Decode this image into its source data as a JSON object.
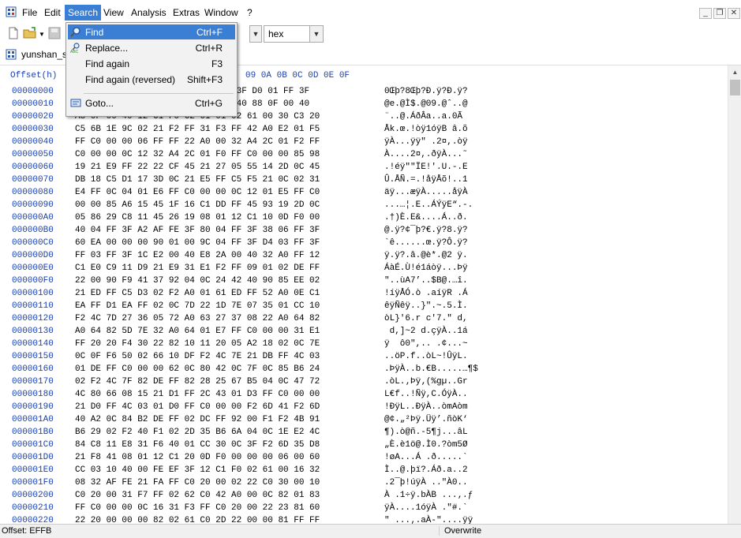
{
  "menubar": {
    "items": [
      "File",
      "Edit",
      "Search",
      "View",
      "Analysis",
      "Extras",
      "Window",
      "?"
    ],
    "active": "Search"
  },
  "toolbar": {
    "encoding_value": "hex"
  },
  "tab": {
    "label": "yunshan_s"
  },
  "hexview": {
    "offset_header": "Offset(h)",
    "column_header": "09 0A 0B 0C 0D 0E 0F",
    "rows": [
      {
        "off": "00000000",
        "hex": "                         03 FF 3F D0 01 FF 3F",
        "asc": "0Œþ?8Œþ?Ð.ÿ?Ð.ÿ?"
      },
      {
        "off": "00000010",
        "hex": "                         39 00 40 88 0F 00 40",
        "asc": "@e.@Ì$.@09.@ˆ..@"
      },
      {
        "off": "00000020",
        "hex": "A8 0F 00 40 12 C1 F0 C2 61 01 02 61 00 30 C3 20",
        "asc": "¨..@.ÁðÂa..a.0Ã "
      },
      {
        "off": "00000030",
        "hex": "C5 6B 1E 9C 02 21 F2 FF 31 F3 FF 42 A0 E2 01 F5",
        "asc": "Åk.œ.!òÿ1óÿB â.õ"
      },
      {
        "off": "00000040",
        "hex": "FF C0 00 00 06 FF FF 22 A0 00 32 A4 2C 01 F2 FF",
        "asc": "ÿÀ...ÿÿ\" .2¤,.òÿ"
      },
      {
        "off": "00000050",
        "hex": "C0 00 00 0C 12 32 A4 2C 01 F0 FF C0 00 00 85 98",
        "asc": "À....2¤,.ðÿÀ...˜"
      },
      {
        "off": "00000060",
        "hex": "19 21 E9 FF 22 22 CF 45 21 27 05 55 14 2D 0C 45",
        "asc": ".!éÿ\"\"ÏE!'.U.-.E"
      },
      {
        "off": "00000070",
        "hex": "DB 18 C5 D1 17 3D 0C 21 E5 FF C5 F5 21 0C 02 31",
        "asc": "Û.ÅÑ.=.!åÿÅõ!..1"
      },
      {
        "off": "00000080",
        "hex": "E4 FF 0C 04 01 E6 FF C0 00 00 0C 12 01 E5 FF C0",
        "asc": "äÿ...æÿÀ.....åÿÀ"
      },
      {
        "off": "00000090",
        "hex": "00 00 85 A6 15 45 1F 16 C1 DD FF 45 93 19 2D 0C",
        "asc": "...…¦.E..ÁÝÿE“.-."
      },
      {
        "off": "000000A0",
        "hex": "05 86 29 C8 11 45 26 19 08 01 12 C1 10 0D F0 00",
        "asc": ".†)È.E&....Á..ð."
      },
      {
        "off": "000000B0",
        "hex": "40 04 FF 3F A2 AF FE 3F 80 04 FF 3F 38 06 FF 3F",
        "asc": "@.ÿ?¢¯þ?€.ÿ?8.ÿ?"
      },
      {
        "off": "000000C0",
        "hex": "60 EA 00 00 00 90 01 00 9C 04 FF 3F D4 03 FF 3F",
        "asc": "`ê......œ.ÿ?Ô.ÿ?"
      },
      {
        "off": "000000D0",
        "hex": "FF 03 FF 3F 1C E2 00 40 E8 2A 00 40 32 A0 FF 12",
        "asc": "ÿ.ÿ?.â.@è*.@2 ÿ."
      },
      {
        "off": "000000E0",
        "hex": "C1 E0 C9 11 D9 21 E9 31 E1 F2 FF 09 01 02 DE FF",
        "asc": "ÁàÉ.Ù!é1áòÿ...Þÿ"
      },
      {
        "off": "000000F0",
        "hex": "22 00 90 F9 41 37 92 04 0C 24 42 40 90 85 EE 02",
        "asc": "\"..ùA7’..$B@.…î."
      },
      {
        "off": "00000100",
        "hex": "21 ED FF C5 D3 02 F2 A0 01 61 ED FF 52 A0 0E C1",
        "asc": "!íÿÅÓ.ò .aíÿR .Á"
      },
      {
        "off": "00000110",
        "hex": "EA FF D1 EA FF 02 0C 7D 22 1D 7E 07 35 01 CC 10",
        "asc": "êÿÑêÿ..}\".~.5.Ì."
      },
      {
        "off": "00000120",
        "hex": "F2 4C 7D 27 36 05 72 A0 63 27 37 08 22 A0 64 82",
        "asc": "òL}'6.r c'7.\" d,"
      },
      {
        "off": "00000130",
        "hex": "A0 64 82 5D 7E 32 A0 64 01 E7 FF C0 00 00 31 E1",
        "asc": " d,]~2 d.çÿÀ..1á"
      },
      {
        "off": "00000140",
        "hex": "FF 20 20 F4 30 22 82 10 11 20 05 A2 18 02 0C 7E",
        "asc": "ÿ  ô0\",.. .¢...~"
      },
      {
        "off": "00000150",
        "hex": "0C 0F F6 50 02 66 10 DF F2 4C 7E 21 DB FF 4C 03",
        "asc": "..öP.f..òL~!ÛÿL."
      },
      {
        "off": "00000160",
        "hex": "01 DE FF C0 00 00 62 0C 80 42 0C 7F 0C 85 B6 24",
        "asc": ".ÞÿÀ..b.€B.....…¶$"
      },
      {
        "off": "00000170",
        "hex": "02 F2 4C 7F 82 DE FF 82 28 25 67 B5 04 0C 47 72",
        "asc": ".òL.‚Þÿ‚(%gµ..Gr"
      },
      {
        "off": "00000180",
        "hex": "4C 80 66 08 15 21 D1 FF 2C 43 01 D3 FF C0 00 00",
        "asc": "L€f..!Ñÿ,C.ÓÿÀ.."
      },
      {
        "off": "00000190",
        "hex": "21 D0 FF 4C 03 01 D0 FF C0 00 00 F2 6D 41 F2 6D",
        "asc": "!ÐÿL..ÐÿÀ..òmAòm"
      },
      {
        "off": "000001A0",
        "hex": "40 A2 0C 84 B2 DE FF 02 DC FF 92 00 F1 F2 4B 91",
        "asc": "@¢.„²Þÿ.Üÿ’.ñòK‘"
      },
      {
        "off": "000001B0",
        "hex": "B6 29 02 F2 40 F1 02 2D 35 B6 6A 04 0C 1E E2 4C",
        "asc": "¶).ò@ñ.-5¶j...âL"
      },
      {
        "off": "000001C0",
        "hex": "84 C8 11 E8 31 F6 40 01 CC 30 0C 3F F2 6D 35 D8",
        "asc": "„È.è1ö@.Ì0.?òm5Ø"
      },
      {
        "off": "000001D0",
        "hex": "21 F8 41 08 01 12 C1 20 0D F0 00 00 00 06 00 60",
        "asc": "!øA...Á .ð.....`"
      },
      {
        "off": "000001E0",
        "hex": "CC 03 10 40 00 FE EF 3F 12 C1 F0 02 61 00 16 32",
        "asc": "Ì..@.þï?.Áð.a..2"
      },
      {
        "off": "000001F0",
        "hex": "08 32 AF FE 21 FA FF C0 20 00 02 22 C0 30 00 10",
        "asc": ".2¯þ!úÿÀ ..\"À0.."
      },
      {
        "off": "00000200",
        "hex": "C0 20 00 31 F7 FF 02 62 C0 42 A0 00 0C 82 01 83",
        "asc": "À .1÷ÿ.bÀB ...‚.ƒ"
      },
      {
        "off": "00000210",
        "hex": "FF C0 00 00 0C 16 31 F3 FF C0 20 00 22 23 81 60",
        "asc": "ÿÀ....1óÿÀ .\"#.`"
      },
      {
        "off": "00000220",
        "hex": "22 20 00 00 00 82 02 61 C0 2D 22 00 00 81 FF FF",
        "asc": "\" ...‚.aÀ-\"....ÿÿ"
      }
    ]
  },
  "search_menu": {
    "items": [
      {
        "label": "Find",
        "shortcut": "Ctrl+F",
        "icon": "magnifier-icon"
      },
      {
        "label": "Replace...",
        "shortcut": "Ctrl+R",
        "icon": "replace-icon"
      },
      {
        "label": "Find again",
        "shortcut": "F3",
        "icon": ""
      },
      {
        "label": "Find again (reversed)",
        "shortcut": "Shift+F3",
        "icon": ""
      },
      {
        "label": "Goto...",
        "shortcut": "Ctrl+G",
        "icon": "goto-icon"
      }
    ]
  },
  "statusbar": {
    "offset": "Offset: EFFB",
    "mode": "Overwrite"
  },
  "colors": {
    "offset_blue": "#1a3fb4",
    "highlight": "#3b7fd4"
  }
}
